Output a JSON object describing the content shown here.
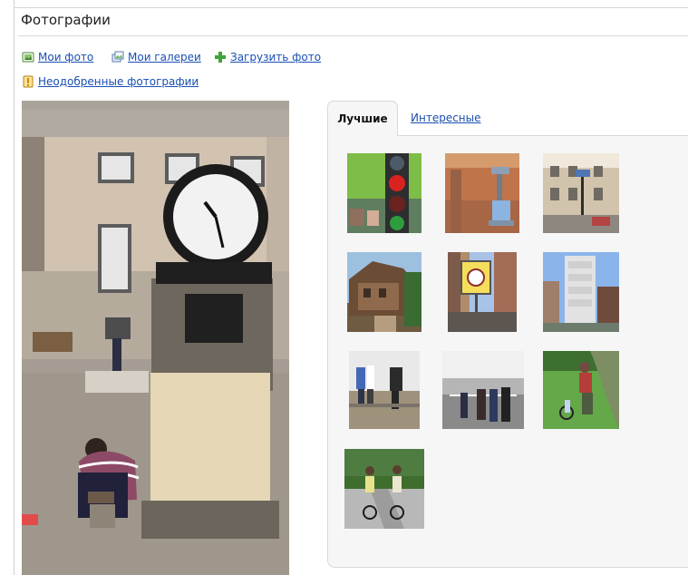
{
  "page": {
    "title": "Фотографии"
  },
  "actions": {
    "my_photos": "Мои фото",
    "my_galleries": "Мои галереи",
    "upload_photo": "Загрузить фото",
    "unapproved_photos": "Неодобренные фотографии"
  },
  "tabs": {
    "best": "Лучшие",
    "interesting": "Интересные"
  },
  "colors": {
    "link": "#1a4fb3",
    "panel_background": "#f6f6f6",
    "border": "#d8d8d8",
    "upload_icon": "#3da63a",
    "warning_icon": "#f2b51f"
  },
  "icons": {
    "my_photos": "photo-icon",
    "my_galleries": "gallery-icon",
    "upload_photo": "plus-icon",
    "unapproved_photos": "warning-icon"
  },
  "featured_photo": {
    "subject": "clock-tower-street-scene"
  },
  "thumbnails": [
    {
      "subject": "traffic-light"
    },
    {
      "subject": "lantern"
    },
    {
      "subject": "street-building"
    },
    {
      "subject": "wooden-house"
    },
    {
      "subject": "sign-post"
    },
    {
      "subject": "monument"
    },
    {
      "subject": "people-on-wall"
    },
    {
      "subject": "observation-deck"
    },
    {
      "subject": "cyclist-park"
    },
    {
      "subject": "cyclists-path"
    }
  ]
}
